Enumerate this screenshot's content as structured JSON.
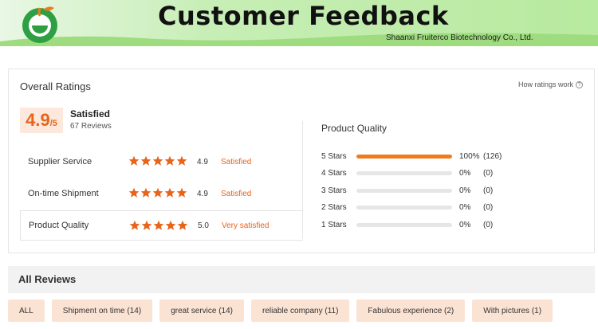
{
  "header": {
    "title": "Customer Feedback",
    "company": "Shaanxi Fruiterco Biotechnology Co., Ltd."
  },
  "ratings": {
    "title": "Overall Ratings",
    "how_link": "How ratings work",
    "score": "4.9",
    "score_suffix": "/5",
    "status": "Satisfied",
    "reviews": "67 Reviews",
    "rows": [
      {
        "label": "Supplier Service",
        "value": "4.9",
        "status": "Satisfied",
        "stars": 4.9
      },
      {
        "label": "On-time Shipment",
        "value": "4.9",
        "status": "Satisfied",
        "stars": 4.9
      },
      {
        "label": "Product Quality",
        "value": "5.0",
        "status": "Very satisfied",
        "stars": 5.0
      }
    ]
  },
  "product_quality": {
    "title": "Product Quality",
    "bars": [
      {
        "stars": "5",
        "label": "Stars",
        "percent": "100%",
        "count": "(126)",
        "fill": 1.0
      },
      {
        "stars": "4",
        "label": "Stars",
        "percent": "0%",
        "count": "(0)",
        "fill": 0.0
      },
      {
        "stars": "3",
        "label": "Stars",
        "percent": "0%",
        "count": "(0)",
        "fill": 0.0
      },
      {
        "stars": "2",
        "label": "Stars",
        "percent": "0%",
        "count": "(0)",
        "fill": 0.0
      },
      {
        "stars": "1",
        "label": "Stars",
        "percent": "0%",
        "count": "(0)",
        "fill": 0.0
      }
    ]
  },
  "reviews": {
    "title": "All Reviews",
    "chips": [
      "ALL",
      "Shipment on time (14)",
      "great service (14)",
      "reliable company (11)",
      "Fabulous experience (2)",
      "With pictures (1)"
    ]
  },
  "colors": {
    "accent": "#e8641b",
    "bar_fill": "#f07b1e",
    "chip_bg": "#fbe3d4",
    "banner_green": "#b8ea9f",
    "logo_green": "#2ea043",
    "logo_orange": "#f07b1e"
  },
  "icons": {
    "logo": "fruit-logo-icon",
    "star": "star-icon",
    "help": "question-circle-icon"
  }
}
